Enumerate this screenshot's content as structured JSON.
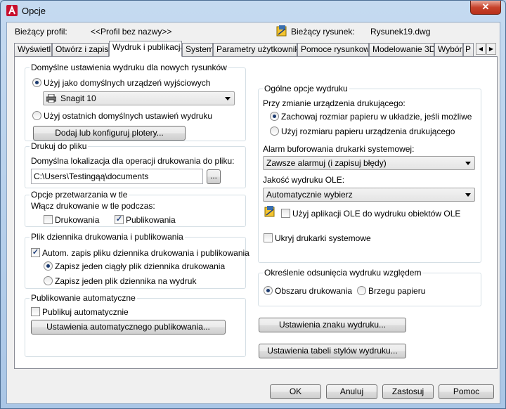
{
  "window": {
    "title": "Opcje",
    "close_label": "✕"
  },
  "profile": {
    "current_profile_label": "Bieżący profil:",
    "current_profile_value": "<<Profil bez nazwy>>",
    "current_drawing_label": "Bieżący rysunek:",
    "current_drawing_value": "Rysunek19.dwg"
  },
  "tabs": [
    {
      "label": "Wyświetl"
    },
    {
      "label": "Otwórz i zapisz"
    },
    {
      "label": "Wydruk i publikacja"
    },
    {
      "label": "System"
    },
    {
      "label": "Parametry użytkownika"
    },
    {
      "label": "Pomoce rysunkowe"
    },
    {
      "label": "Modelowanie 3D"
    },
    {
      "label": "Wybór"
    },
    {
      "label": "P"
    }
  ],
  "tab_scroll": {
    "left": "◀",
    "right": "▶"
  },
  "default_output": {
    "title": "Domyślne ustawienia wydruku dla nowych rysunków",
    "use_default_label": "Użyj jako domyślnych urządzeń wyjściowych",
    "device_value": "Snagit 10",
    "use_last_label": "Użyj ostatnich domyślnych ustawień wydruku",
    "add_plotters_label": "Dodaj lub konfiguruj plotery..."
  },
  "plot_to_file": {
    "title": "Drukuj do pliku",
    "location_label": "Domyślna lokalizacja dla operacji drukowania do pliku:",
    "path_value": "C:\\Users\\Testingąą\\documents",
    "browse_label": "..."
  },
  "background": {
    "title": "Opcje przetwarzania w tle",
    "enable_label": "Włącz drukowanie w tle podczas:",
    "plotting_label": "Drukowania",
    "plotting_checked": false,
    "publishing_label": "Publikowania",
    "publishing_checked": true
  },
  "log": {
    "title": "Plik dziennika drukowania i publikowania",
    "auto_save_label": "Autom. zapis pliku dziennika drukowania i publikowania",
    "auto_save_checked": true,
    "continuous_label": "Zapisz jeden ciągły plik dziennika drukowania",
    "per_plot_label": "Zapisz jeden plik dziennika na wydruk"
  },
  "autopublish": {
    "title": "Publikowanie automatyczne",
    "auto_label": "Publikuj automatycznie",
    "auto_checked": false,
    "settings_label": "Ustawienia automatycznego publikowania..."
  },
  "general": {
    "title": "Ogólne opcje wydruku",
    "change_device_label": "Przy zmianie urządzenia drukującego:",
    "keep_size_label": "Zachowaj rozmiar papieru w układzie, jeśli możliwe",
    "use_device_size_label": "Użyj rozmiaru papieru urządzenia drukującego",
    "spool_label": "Alarm buforowania drukarki systemowej:",
    "spool_value": "Zawsze alarmuj (i zapisuj błędy)",
    "ole_quality_label": "Jakość wydruku OLE:",
    "ole_quality_value": "Automatycznie wybierz",
    "use_ole_app_label": "Użyj aplikacji OLE do wydruku obiektów OLE",
    "hide_printers_label": "Ukryj drukarki systemowe"
  },
  "offset": {
    "title": "Określenie odsunięcia wydruku względem",
    "printable_label": "Obszaru drukowania",
    "edge_label": "Brzegu papieru"
  },
  "stamp_label": "Ustawienia znaku wydruku...",
  "plot_style_label": "Ustawienia tabeli stylów wydruku...",
  "footer": {
    "ok": "OK",
    "cancel": "Anuluj",
    "apply": "Zastosuj",
    "help": "Pomoc"
  }
}
